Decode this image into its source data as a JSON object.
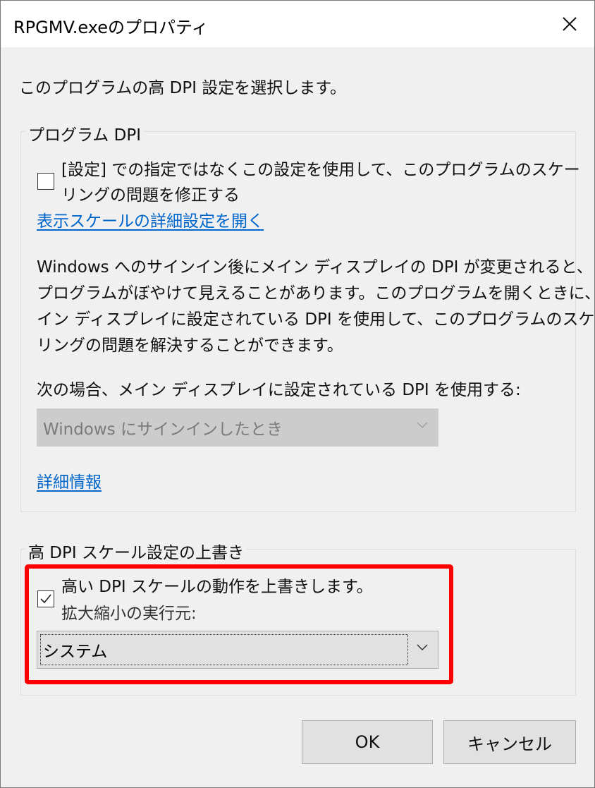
{
  "window": {
    "title": "RPGMV.exeのプロパティ",
    "close_icon": "close-icon"
  },
  "intro": "このプログラムの高 DPI 設定を選択します。",
  "program_dpi": {
    "legend": "プログラム DPI",
    "checkbox_line1": "[設定] での指定ではなくこの設定を使用して、このプログラムのスケー",
    "checkbox_line2": "リングの問題を修正する",
    "checked": false,
    "link_advanced_scale": "表示スケールの詳細設定を開く",
    "description": [
      "Windows へのサインイン後にメイン ディスプレイの DPI が変更されると、",
      "プログラムがぼやけて見えることがあります。このプログラムを開くときに、メ",
      "イン ディスプレイに設定されている DPI を使用して、このプログラムのスケー",
      "リングの問題を解決することができます。"
    ],
    "when_label": "次の場合、メイン ディスプレイに設定されている DPI を使用する:",
    "when_select_value": "Windows にサインインしたとき",
    "link_more_info": "詳細情報"
  },
  "override": {
    "legend": "高 DPI スケール設定の上書き",
    "checkbox_label": "高い DPI スケールの動作を上書きします。",
    "checked": true,
    "performer_label": "拡大縮小の実行元:",
    "performer_value": "システム",
    "highlight_color": "#ff0000"
  },
  "buttons": {
    "ok": "OK",
    "cancel": "キャンセル"
  }
}
